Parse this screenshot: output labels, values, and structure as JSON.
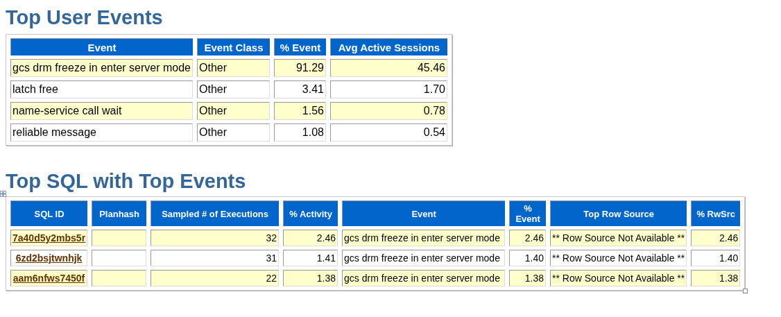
{
  "sections": [
    {
      "title": "Top User Events",
      "table": {
        "columns": [
          {
            "label": "Event",
            "kind": "text"
          },
          {
            "label": "Event Class",
            "kind": "text"
          },
          {
            "label": "% Event",
            "kind": "number"
          },
          {
            "label": "Avg Active Sessions",
            "kind": "number"
          }
        ],
        "rows": [
          [
            "gcs drm freeze in enter server mode",
            "Other",
            "91.29",
            "45.46"
          ],
          [
            "latch free",
            "Other",
            "3.41",
            "1.70"
          ],
          [
            "name-service call wait",
            "Other",
            "1.56",
            "0.78"
          ],
          [
            "reliable message",
            "Other",
            "1.08",
            "0.54"
          ]
        ]
      }
    },
    {
      "title": "Top SQL with Top Events",
      "table": {
        "columns": [
          {
            "label": "SQL ID",
            "kind": "link"
          },
          {
            "label": "Planhash",
            "kind": "text"
          },
          {
            "label": "Sampled # of Executions",
            "kind": "number"
          },
          {
            "label": "% Activity",
            "kind": "number"
          },
          {
            "label": "Event",
            "kind": "text"
          },
          {
            "label": "% Event",
            "kind": "number"
          },
          {
            "label": "Top Row Source",
            "kind": "text"
          },
          {
            "label": "% RwSrc",
            "kind": "number"
          }
        ],
        "rows": [
          [
            "7a40d5y2mbs5r",
            null,
            "32",
            "2.46",
            "gcs drm freeze in enter server mode",
            "2.46",
            "** Row Source Not Available **",
            "2.46"
          ],
          [
            "6zd2bsjtwnhjk",
            null,
            "31",
            "1.41",
            "gcs drm freeze in enter server mode",
            "1.40",
            "** Row Source Not Available **",
            "1.40"
          ],
          [
            "aam6nfws7450f",
            null,
            "22",
            "1.38",
            "gcs drm freeze in enter server mode",
            "1.38",
            "** Row Source Not Available **",
            "1.38"
          ]
        ]
      }
    }
  ]
}
